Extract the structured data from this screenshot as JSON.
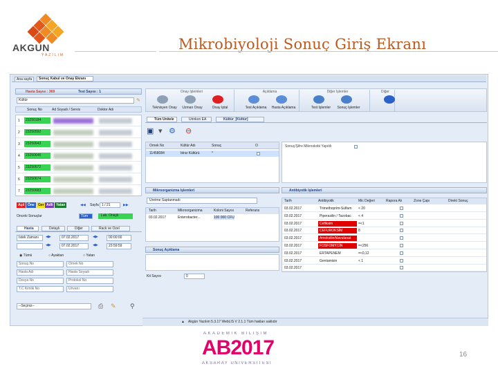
{
  "slide": {
    "title": "Mikrobiyoloji Sonuç Giriş Ekranı",
    "page_number": "16"
  },
  "logo_top": {
    "name": "AKGUN",
    "tagline": "YAZILIM"
  },
  "logo_bottom": {
    "line1": "AKADEMİK BİLİŞİM",
    "line2": "AB2017",
    "line3": "AKSARAY ÜNİVERSİTESİ"
  },
  "app": {
    "tabs": [
      "Ana sayfa",
      "Sonuç Kabul ve Onay Ekranı"
    ],
    "left_header": {
      "hasta_sayisi": "Hasta Sayısı : 369",
      "test_sayisi": "Test Sayısı : 1"
    },
    "filter_value": "Kültür",
    "left_columns": [
      "Sonuç No",
      "Ad Soyadı / Servis",
      "Doktor Adı"
    ],
    "left_rows": [
      {
        "idx": "1",
        "no": "23250184"
      },
      {
        "idx": "2",
        "no": "23250592"
      },
      {
        "idx": "3",
        "no": "23250643"
      },
      {
        "idx": "4",
        "no": "23250646"
      },
      {
        "idx": "5",
        "no": "23250672"
      },
      {
        "idx": "6",
        "no": "23250674"
      },
      {
        "idx": "7",
        "no": "23250683"
      }
    ],
    "status_badges": [
      "Açıl",
      "Öne",
      "Ger",
      "Adli",
      "Yatan"
    ],
    "paging": {
      "label": "Sayfa",
      "value": "1 / 21"
    },
    "sonuc_label": "Önceki Sonuçlar",
    "sonuc_select": "Tüm",
    "sonuc_badge": "Lab. Onaylı",
    "left_subtabs": [
      "Hasta",
      "Detaylı",
      "Diğer",
      "Rack ve Özel"
    ],
    "date_rows": [
      {
        "label": "İstek Zamanı",
        "date": "07.02.2017",
        "time": "00:00:00"
      },
      {
        "label": "",
        "date": "07.02.2017",
        "time": "23:59:59"
      }
    ],
    "radio_labels": [
      "Tümü",
      "Ayaktan",
      "Yatan"
    ],
    "search_fields": [
      [
        "Sonuç No",
        "Örnek No"
      ],
      [
        "Hasta Adı",
        "Hasta Soyadı"
      ],
      [
        "Dosya No",
        "Protokol No"
      ],
      [
        "T.C Kimlik No",
        "Unvanı"
      ]
    ],
    "bottom_select": "--Seçiniz--",
    "toolbar_groups": [
      {
        "title": "Onay İşlemleri",
        "buttons": [
          "Teknisyen Onay",
          "Uzman Onay",
          "Onay İptal"
        ]
      },
      {
        "title": "Açıklama",
        "buttons": [
          "Test Açıklama",
          "Hasta Açıklama"
        ]
      },
      {
        "title": "Diğer İşlemler",
        "buttons": [
          "Test İşlemler",
          "Sonuç İşlemler"
        ]
      },
      {
        "title": "Diğer",
        "buttons": [
          ""
        ]
      }
    ],
    "result_tabs": [
      "Tüm Ünitele",
      "Ürinkon EA",
      "Kültür_[Kültür]"
    ],
    "result_columns": [
      "Örnek No",
      "Kültür Adı",
      "Sonuç",
      "O"
    ],
    "result_row": {
      "ornek": "11458084",
      "ad": "İdrar Kültürü",
      "sonuc": "*"
    },
    "micro_note": "Sonuç/Şifre Mikroskobi Yapıldı",
    "mikro_panel": {
      "title": "Mikroorganizma İşlemleri",
      "search_value": "Üretme Saptanmadı",
      "columns": [
        "Tarih",
        "Mikroorganizma",
        "Koloni Sayısı",
        "Referans"
      ],
      "row": {
        "tarih": "03.02.2017",
        "mikro": "Enterobacter...",
        "koloni": "100 000 CFU"
      }
    },
    "antibiyotik_panel": {
      "title": "Antibiyotik İşlemleri",
      "columns": [
        "Tarih",
        "Antibiyotik",
        "Mic Değeri",
        "Rapora Alı",
        "Zone Çapı",
        "Direkt Sonuç"
      ],
      "rows": [
        {
          "tarih": "03.02.2017",
          "ad": "Trimethoprim-Sulfam",
          "mic": "< 20",
          "red": false
        },
        {
          "tarih": "03.02.2017",
          "ad": "Piperasilin / Tazobac",
          "mic": "< 4",
          "red": false
        },
        {
          "tarih": "03.02.2017",
          "ad": "Cefiksim",
          "mic": "=<1",
          "red": true
        },
        {
          "tarih": "03.02.2017",
          "ad": "CEFUROKSİM",
          "mic": "8",
          "red": true
        },
        {
          "tarih": "03.02.2017",
          "ad": "Amoksilin/klavulanat",
          "mic": "",
          "red": true
        },
        {
          "tarih": "03.02.2017",
          "ad": "FOSFOMYCİN",
          "mic": "=<256",
          "red": true
        },
        {
          "tarih": "03.02.2017",
          "ad": "ERTAPENEM",
          "mic": "=<0,12",
          "red": false
        },
        {
          "tarih": "03.02.2017",
          "ad": "Gentamisin",
          "mic": "< 1",
          "red": false
        },
        {
          "tarih": "03.02.2017",
          "ad": "",
          "mic": "",
          "red": false
        }
      ]
    },
    "sonuc_aciklama": "Sonuç Açıklama",
    "kit_label": "Kit Sayısı",
    "kit_value": "0",
    "statusbar": "Akgün Yazılım 5.3.17  WebLİS V 2.1.1  Tüm hakları saklıdır",
    "colors": {
      "accent": "#b85a1f",
      "frame": "#e4ecf7",
      "green": "#2ecc40",
      "red": "#e00000"
    }
  }
}
